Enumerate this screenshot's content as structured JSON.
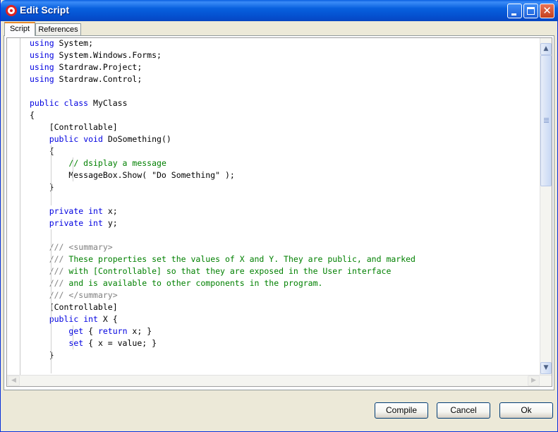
{
  "window": {
    "title": "Edit Script",
    "icon": "app-icon",
    "controls": [
      "minimize-icon",
      "maximize-icon",
      "close-icon"
    ]
  },
  "tabs": [
    {
      "label": "Script",
      "active": true
    },
    {
      "label": "References",
      "active": false
    }
  ],
  "editor": {
    "lines": [
      [
        {
          "t": "using",
          "c": "kw"
        },
        {
          "t": " System;"
        }
      ],
      [
        {
          "t": "using",
          "c": "kw"
        },
        {
          "t": " System.Windows.Forms;"
        }
      ],
      [
        {
          "t": "using",
          "c": "kw"
        },
        {
          "t": " Stardraw.Project;"
        }
      ],
      [
        {
          "t": "using",
          "c": "kw"
        },
        {
          "t": " Stardraw.Control;"
        }
      ],
      [],
      [
        {
          "t": "public",
          "c": "kw"
        },
        {
          "t": " "
        },
        {
          "t": "class",
          "c": "kw"
        },
        {
          "t": " MyClass"
        }
      ],
      [
        {
          "t": "{"
        }
      ],
      [
        {
          "t": "    [Controllable]"
        }
      ],
      [
        {
          "t": "    "
        },
        {
          "t": "public",
          "c": "kw"
        },
        {
          "t": " "
        },
        {
          "t": "void",
          "c": "kw"
        },
        {
          "t": " DoSomething()"
        }
      ],
      [
        {
          "t": "    {"
        }
      ],
      [
        {
          "t": "        "
        },
        {
          "t": "// dsiplay a message",
          "c": "cm"
        }
      ],
      [
        {
          "t": "        MessageBox.Show( \"Do Something\" );"
        }
      ],
      [
        {
          "t": "    }"
        }
      ],
      [],
      [
        {
          "t": "    "
        },
        {
          "t": "private",
          "c": "kw"
        },
        {
          "t": " "
        },
        {
          "t": "int",
          "c": "kw"
        },
        {
          "t": " x;"
        }
      ],
      [
        {
          "t": "    "
        },
        {
          "t": "private",
          "c": "kw"
        },
        {
          "t": " "
        },
        {
          "t": "int",
          "c": "kw"
        },
        {
          "t": " y;"
        }
      ],
      [],
      [
        {
          "t": "    "
        },
        {
          "t": "///",
          "c": "doc"
        },
        {
          "t": " "
        },
        {
          "t": "<summary>",
          "c": "doc"
        }
      ],
      [
        {
          "t": "    "
        },
        {
          "t": "///",
          "c": "doc"
        },
        {
          "t": " These properties set the values of X and Y. They are public, and marked",
          "c": "cm"
        }
      ],
      [
        {
          "t": "    "
        },
        {
          "t": "///",
          "c": "doc"
        },
        {
          "t": " with [Controllable] so that they are exposed in the User interface",
          "c": "cm"
        }
      ],
      [
        {
          "t": "    "
        },
        {
          "t": "///",
          "c": "doc"
        },
        {
          "t": " and is available to other components in the program.",
          "c": "cm"
        }
      ],
      [
        {
          "t": "    "
        },
        {
          "t": "///",
          "c": "doc"
        },
        {
          "t": " "
        },
        {
          "t": "</summary>",
          "c": "doc"
        }
      ],
      [
        {
          "t": "    [Controllable]"
        }
      ],
      [
        {
          "t": "    "
        },
        {
          "t": "public",
          "c": "kw"
        },
        {
          "t": " "
        },
        {
          "t": "int",
          "c": "kw"
        },
        {
          "t": " X {"
        }
      ],
      [
        {
          "t": "        "
        },
        {
          "t": "get",
          "c": "kw"
        },
        {
          "t": " { "
        },
        {
          "t": "return",
          "c": "kw"
        },
        {
          "t": " x; }"
        }
      ],
      [
        {
          "t": "        "
        },
        {
          "t": "set",
          "c": "kw"
        },
        {
          "t": " { x = value; }"
        }
      ],
      [
        {
          "t": "    }"
        }
      ],
      []
    ]
  },
  "buttons": {
    "compile": "Compile",
    "cancel": "Cancel",
    "ok": "Ok"
  },
  "colors": {
    "keyword": "#0000E0",
    "comment": "#008000",
    "doc_tag": "#808080",
    "titlebar": "#0553D2"
  }
}
